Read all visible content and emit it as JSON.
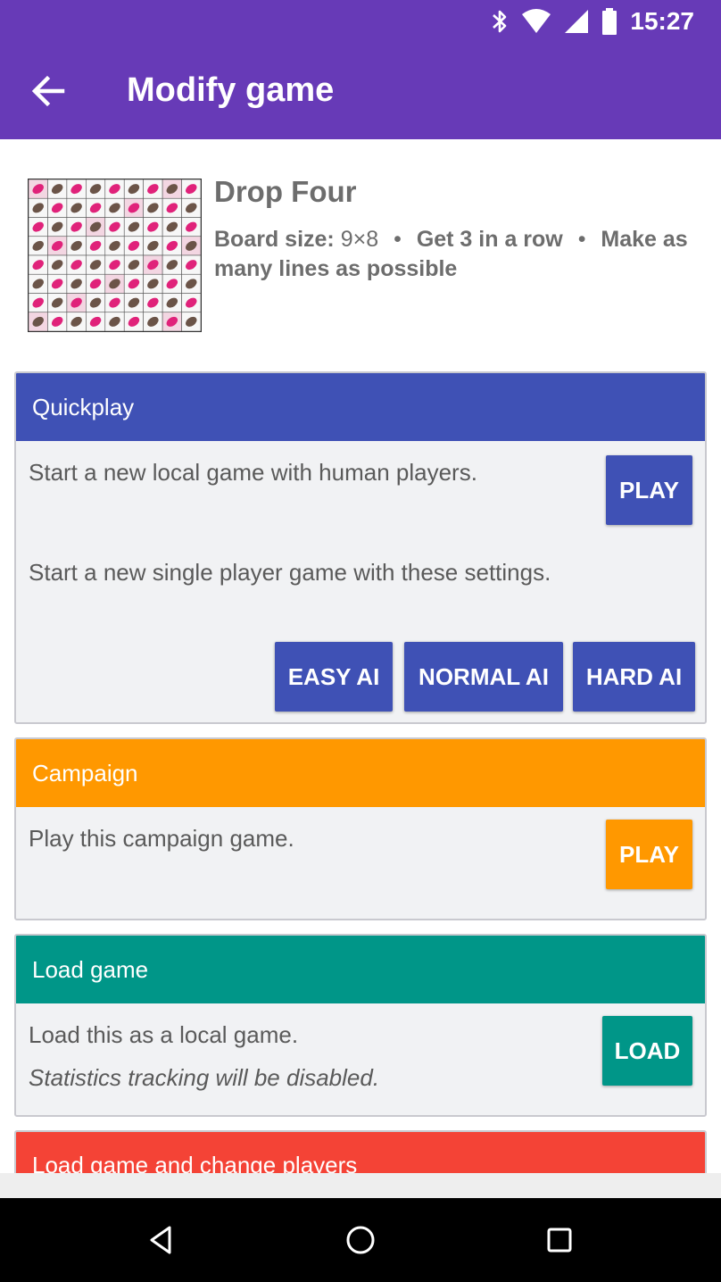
{
  "status_bar": {
    "time": "15:27"
  },
  "app_bar": {
    "title": "Modify game",
    "color": "#673ab7"
  },
  "game": {
    "name": "Drop Four",
    "board_size_label": "Board size:",
    "board_size_value": "9×8",
    "goal": "Get 3 in a row",
    "rule": "Make as many lines as possible",
    "dot": "•"
  },
  "quickplay": {
    "title": "Quickplay",
    "color": "#3f51b5",
    "local_text": "Start a new local game with human players.",
    "play_label": "PLAY",
    "single_text": "Start a new single player game with these settings.",
    "easy_label": "EASY AI",
    "normal_label": "NORMAL AI",
    "hard_label": "HARD AI"
  },
  "campaign": {
    "title": "Campaign",
    "color": "#ff9800",
    "text": "Play this campaign game.",
    "play_label": "PLAY"
  },
  "load_game": {
    "title": "Load game",
    "color": "#009688",
    "text": "Load this as a local game.",
    "note": "Statistics tracking will be disabled.",
    "load_label": "LOAD"
  },
  "load_change": {
    "title": "Load game and change players",
    "color": "#f44336"
  },
  "icons": {
    "back": "arrow-left-icon",
    "bluetooth": "bluetooth-icon",
    "wifi": "wifi-icon",
    "signal": "signal-icon",
    "battery": "battery-icon",
    "nav_back": "nav-back-icon",
    "nav_home": "nav-home-icon",
    "nav_recents": "nav-recents-icon"
  }
}
